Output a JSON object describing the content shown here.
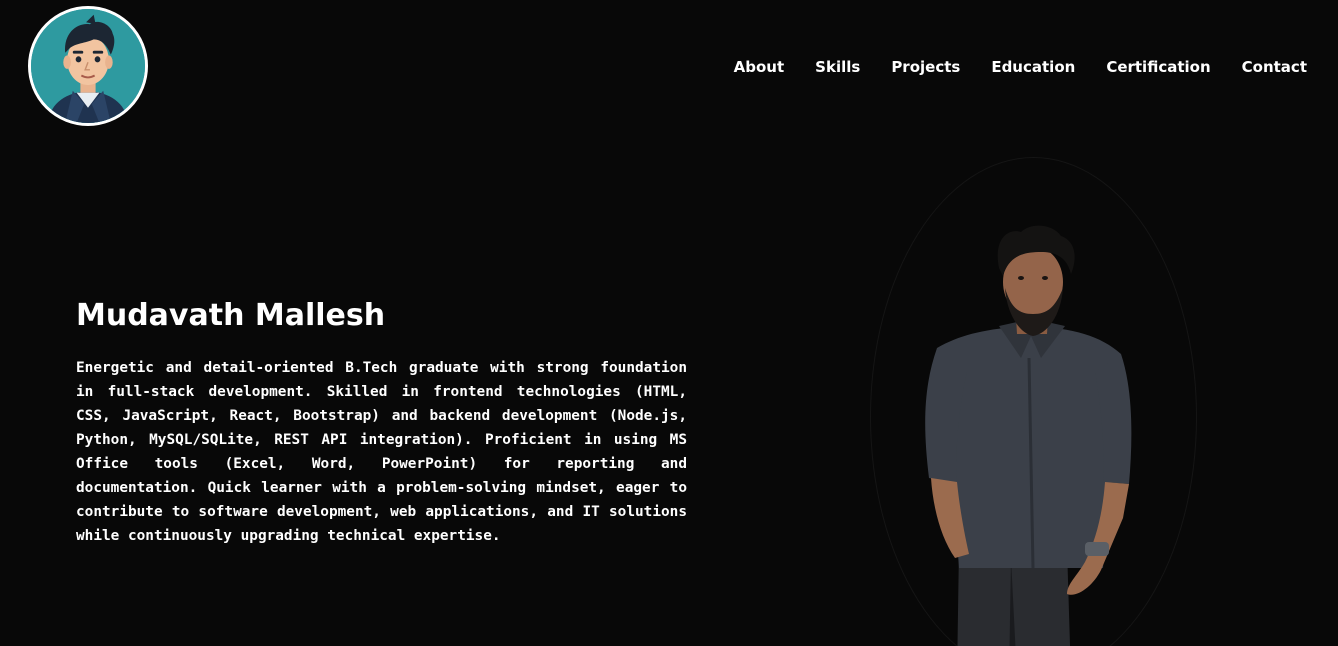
{
  "header": {
    "avatar_icon": "cartoon-avatar-icon",
    "nav": [
      {
        "label": "About"
      },
      {
        "label": "Skills"
      },
      {
        "label": "Projects"
      },
      {
        "label": "Education"
      },
      {
        "label": "Certification"
      },
      {
        "label": "Contact"
      }
    ]
  },
  "hero": {
    "name": "Mudavath Mallesh",
    "bio": "Energetic and detail-oriented B.Tech graduate with strong foundation in full-stack development. Skilled in frontend technologies (HTML, CSS, JavaScript, React, Bootstrap) and backend development (Node.js, Python, MySQL/SQLite, REST API integration). Proficient in using MS Office tools (Excel, Word, PowerPoint) for reporting and documentation. Quick learner with a problem-solving mindset, eager to contribute to software development, web applications, and IT solutions while continuously upgrading technical expertise.",
    "photo_icon": "profile-photo"
  },
  "colors": {
    "background": "#080808",
    "text": "#ffffff",
    "avatar_bg": "#2e9aa0"
  }
}
